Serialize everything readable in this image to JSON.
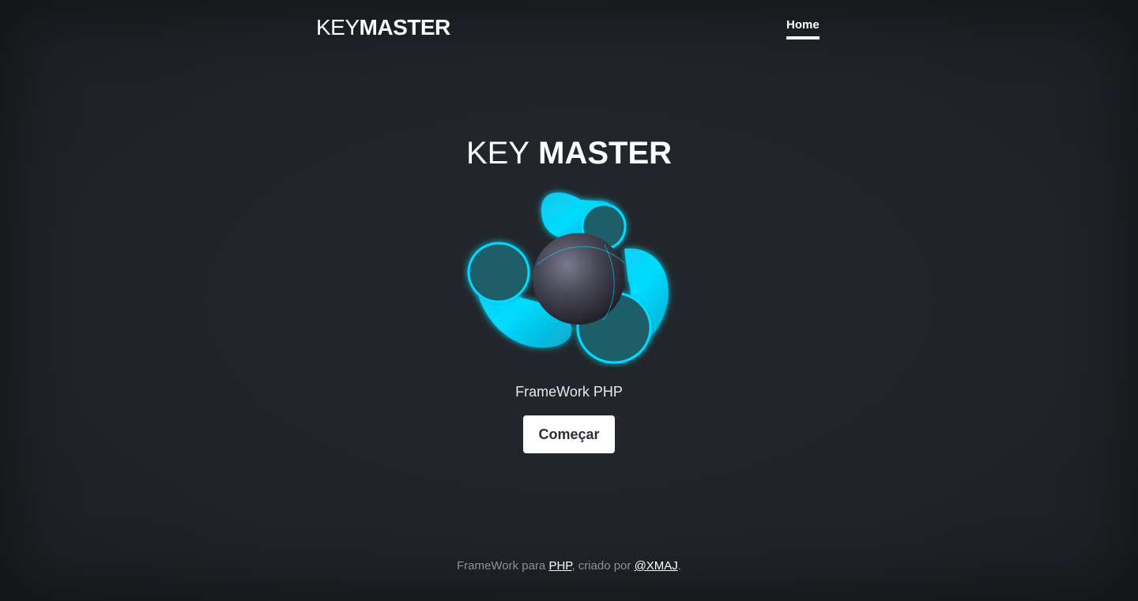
{
  "header": {
    "brand_light": "KEY",
    "brand_bold": "MASTER",
    "nav": {
      "home_label": "Home"
    }
  },
  "hero": {
    "title_light": "KEY",
    "title_bold": "MASTER",
    "logo_icon": "keymaster-orbit-logo-icon",
    "subtitle": "FrameWork PHP",
    "button_label": "Começar"
  },
  "footer": {
    "text_1": "FrameWork para ",
    "link_php": "PHP",
    "text_2": ", criado por ",
    "link_author": "@XMAJ",
    "text_3": "."
  },
  "colors": {
    "background": "#212429",
    "accent": "#00d8ff",
    "text": "#ffffff",
    "footer_text": "#8d9096",
    "button_bg": "#ffffff"
  }
}
